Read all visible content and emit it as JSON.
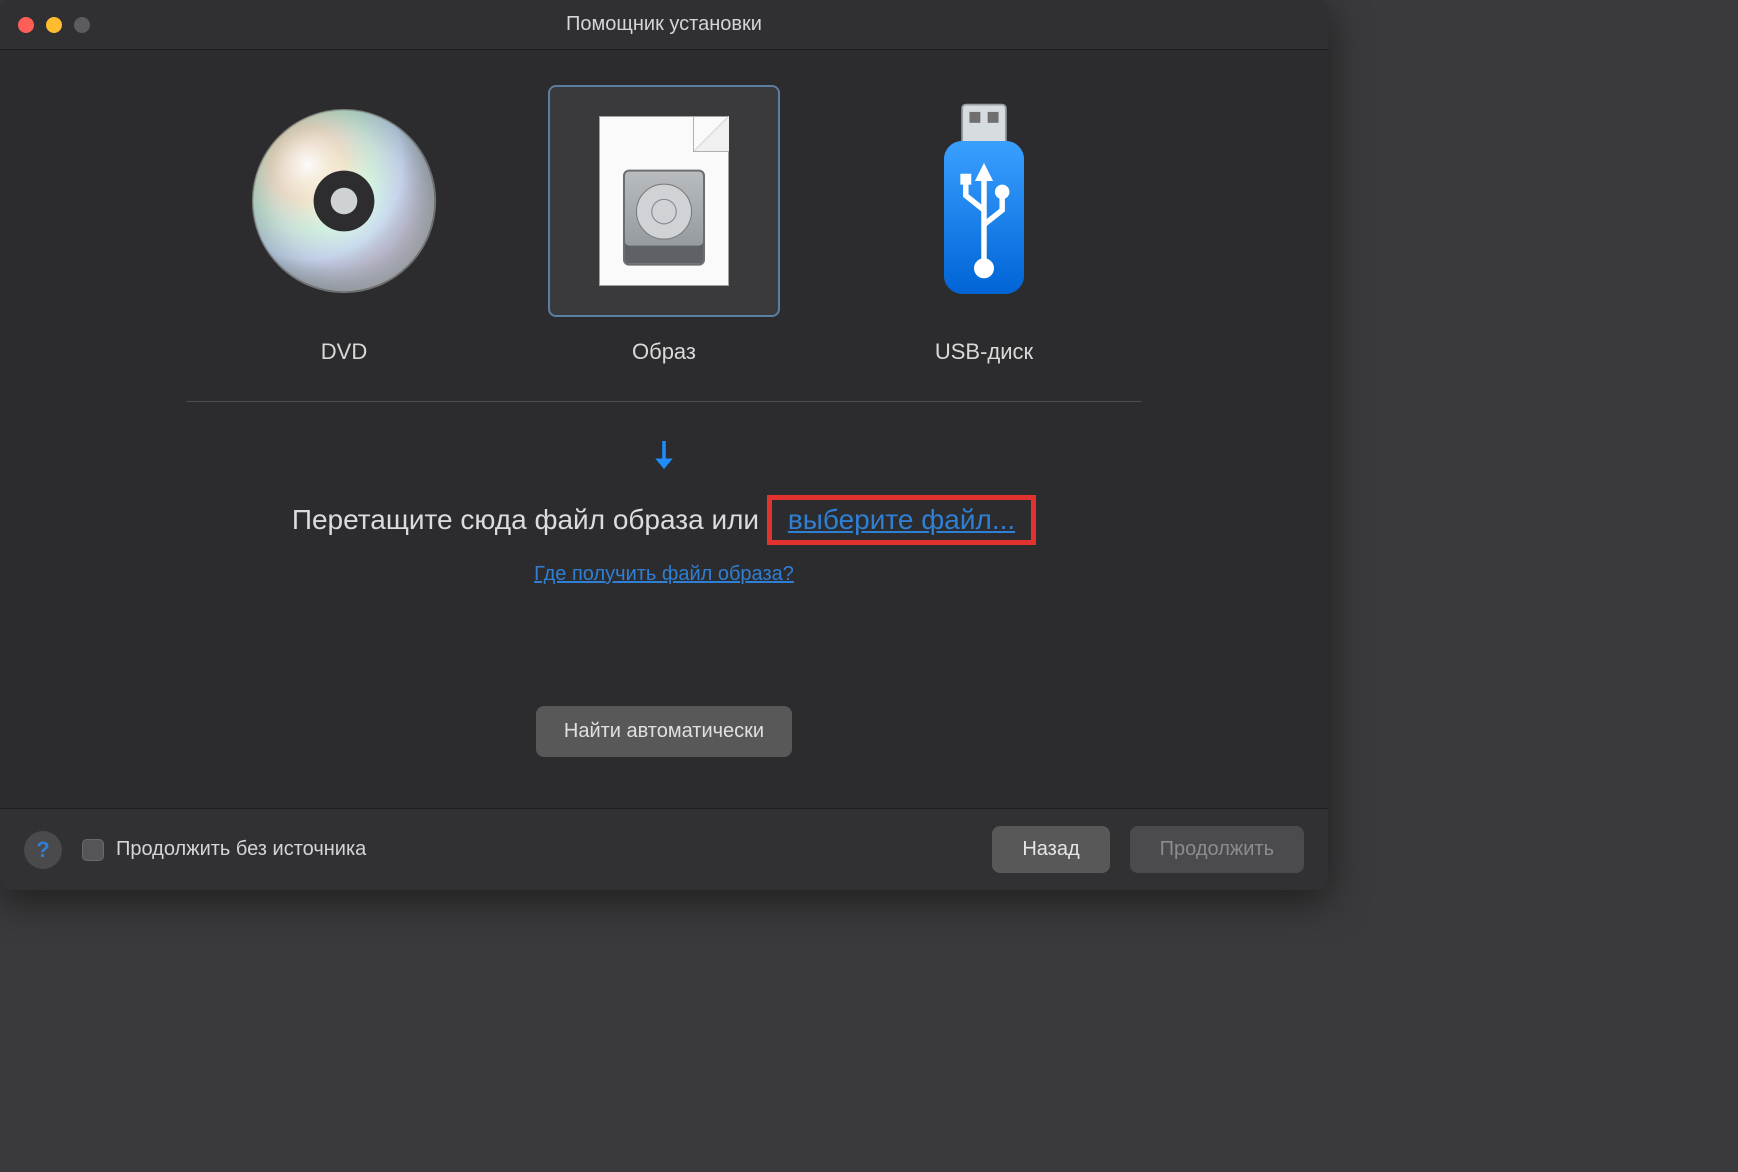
{
  "window": {
    "title": "Помощник установки"
  },
  "options": {
    "dvd": {
      "label": "DVD"
    },
    "image": {
      "label": "Образ",
      "selected": true
    },
    "usb": {
      "label": "USB-диск"
    }
  },
  "drop": {
    "prefix": "Перетащите сюда файл образа или ",
    "choose_link": "выберите файл...",
    "help_link": "Где получить файл образа?"
  },
  "buttons": {
    "auto": "Найти автоматически",
    "back": "Назад",
    "continue": "Продолжить"
  },
  "footer": {
    "checkbox_label": "Продолжить без источника"
  },
  "colors": {
    "accent": "#1f8cff",
    "link": "#2f7fd4",
    "highlight_box": "#e1322e"
  }
}
